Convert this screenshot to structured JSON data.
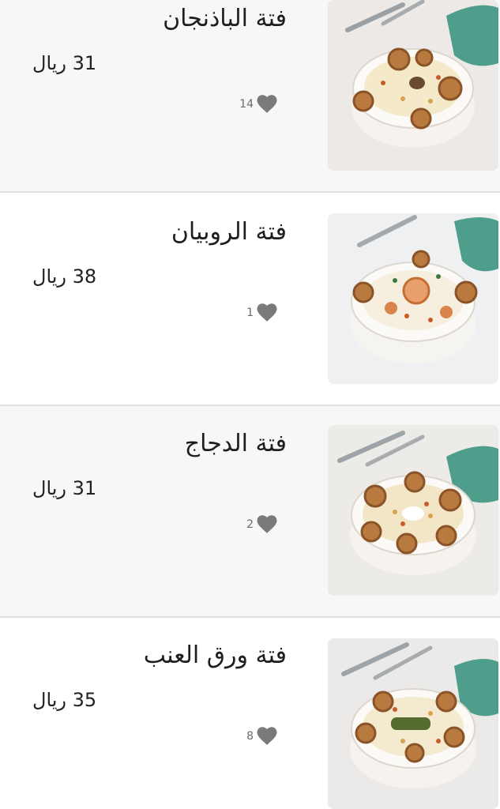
{
  "items": [
    {
      "name": "فتة الباذنجان",
      "price": "31 ريال",
      "likes": "14"
    },
    {
      "name": "فتة الروبيان",
      "price": "38 ريال",
      "likes": "1"
    },
    {
      "name": "فتة الدجاج",
      "price": "31 ريال",
      "likes": "2"
    },
    {
      "name": "فتة ورق العنب",
      "price": "35 ريال",
      "likes": "8"
    }
  ],
  "colors": {
    "card_bg": "#f7f7f7",
    "card_bg_alt": "#ffffff",
    "divider": "#e1e1e1",
    "heart": "#7a7a7a",
    "brand_teal": "#4e9e8b"
  },
  "icons": {
    "like": "heart-icon"
  }
}
